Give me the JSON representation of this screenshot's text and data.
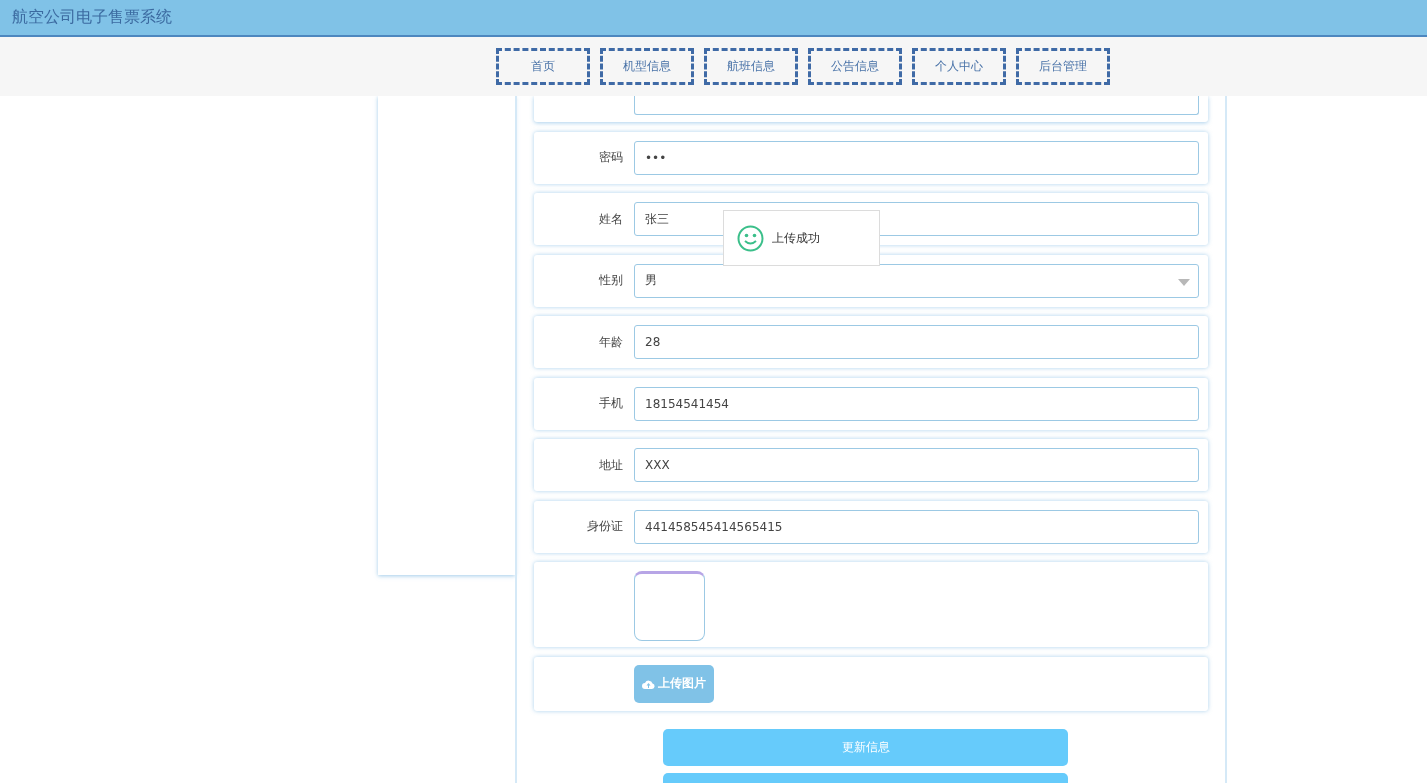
{
  "header": {
    "title": "航空公司电子售票系统"
  },
  "nav": [
    {
      "label": "首页"
    },
    {
      "label": "机型信息"
    },
    {
      "label": "航班信息"
    },
    {
      "label": "公告信息"
    },
    {
      "label": "个人中心"
    },
    {
      "label": "后台管理"
    }
  ],
  "form": {
    "fields": [
      {
        "label": "密码",
        "kind": "text",
        "value": "•••"
      },
      {
        "label": "姓名",
        "kind": "text",
        "value": "张三"
      },
      {
        "label": "性别",
        "kind": "select",
        "value": "男"
      },
      {
        "label": "年龄",
        "kind": "text",
        "value": "28"
      },
      {
        "label": "手机",
        "kind": "text",
        "value": "18154541454"
      },
      {
        "label": "地址",
        "kind": "text",
        "value": "XXX"
      },
      {
        "label": "身份证",
        "kind": "text",
        "value": "441458545414565415"
      }
    ],
    "upload_button": "上传图片",
    "submit_button": "更新信息"
  },
  "toast": {
    "message": "上传成功"
  }
}
